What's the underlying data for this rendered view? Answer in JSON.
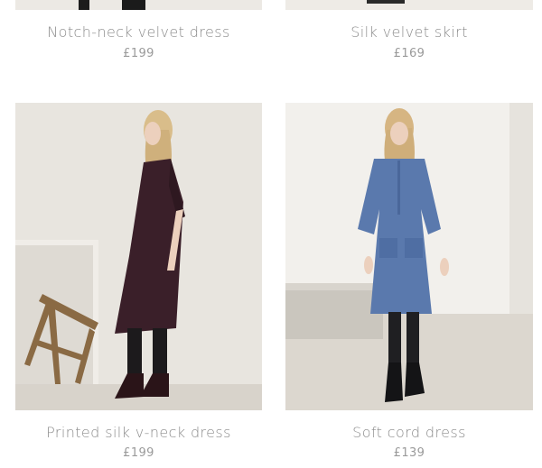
{
  "products": [
    {
      "title": "Notch-neck velvet dress",
      "price": "£199",
      "image": "model-in-velvet-dress"
    },
    {
      "title": "Silk velvet skirt",
      "price": "£169",
      "image": "model-in-silk-velvet-skirt"
    },
    {
      "title": "Printed silk v-neck dress",
      "price": "£199",
      "image": "model-in-printed-silk-dress-with-stool"
    },
    {
      "title": "Soft cord dress",
      "price": "£139",
      "image": "model-in-blue-cord-dress"
    }
  ],
  "colors": {
    "background": "#ffffff",
    "image_bg": "#e9e6e1",
    "title_text": "#8b8b8b",
    "price_text": "#9a9a9a"
  }
}
